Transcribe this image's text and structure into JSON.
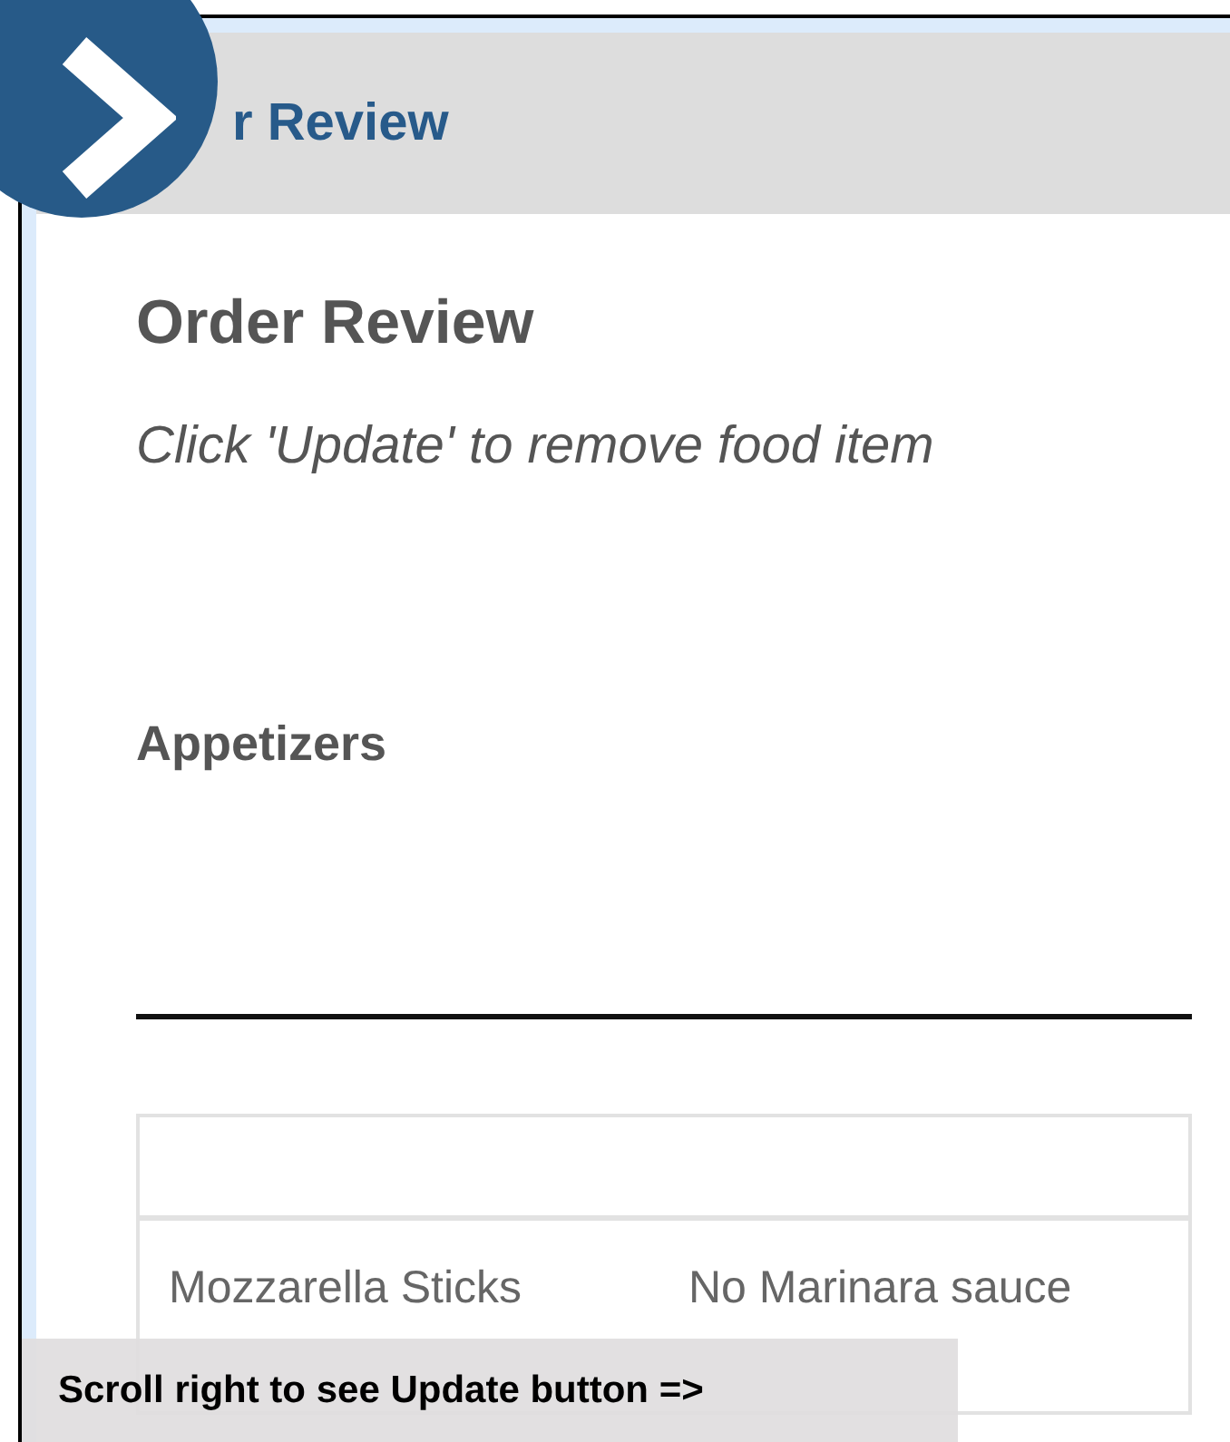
{
  "header": {
    "title": "r Review"
  },
  "page": {
    "title": "Order Review",
    "instruction": "Click 'Update' to remove food item"
  },
  "section": {
    "title": "Appetizers"
  },
  "table": {
    "rows": [
      {
        "item": "Mozzarella Sticks",
        "note": "No Marinara sauce"
      }
    ]
  },
  "overlay": {
    "text": "Scroll right to see Update button =>"
  }
}
